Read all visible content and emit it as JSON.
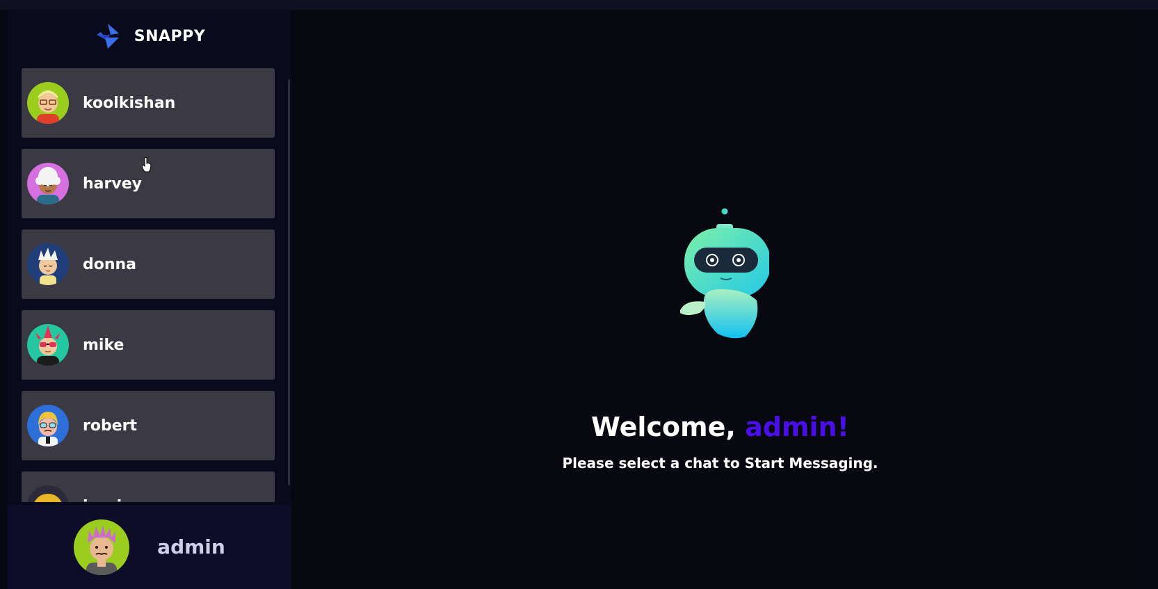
{
  "app": {
    "brand_name": "SNAPPY"
  },
  "contacts": [
    {
      "name": "koolkishan",
      "avatar": "avatar-glasses-red-shirt-icon"
    },
    {
      "name": "harvey",
      "avatar": "avatar-white-hair-icon"
    },
    {
      "name": "donna",
      "avatar": "avatar-spiky-hair-icon"
    },
    {
      "name": "mike",
      "avatar": "avatar-mohawk-sunglasses-icon"
    },
    {
      "name": "robert",
      "avatar": "avatar-blue-hair-glasses-icon"
    },
    {
      "name": "jessica",
      "avatar": "avatar-yellow-helmet-icon"
    }
  ],
  "current_user": {
    "name": "admin",
    "avatar": "avatar-pink-hair-icon"
  },
  "welcome": {
    "greeting": "Welcome, ",
    "username": "admin!",
    "subtitle": "Please select a chat to Start Messaging."
  },
  "colors": {
    "accent": "#4a0ee8",
    "sidebar_bg": "#0a0a1d",
    "contact_bg": "#3a3944",
    "current_user_bg": "#0d0d2a"
  }
}
